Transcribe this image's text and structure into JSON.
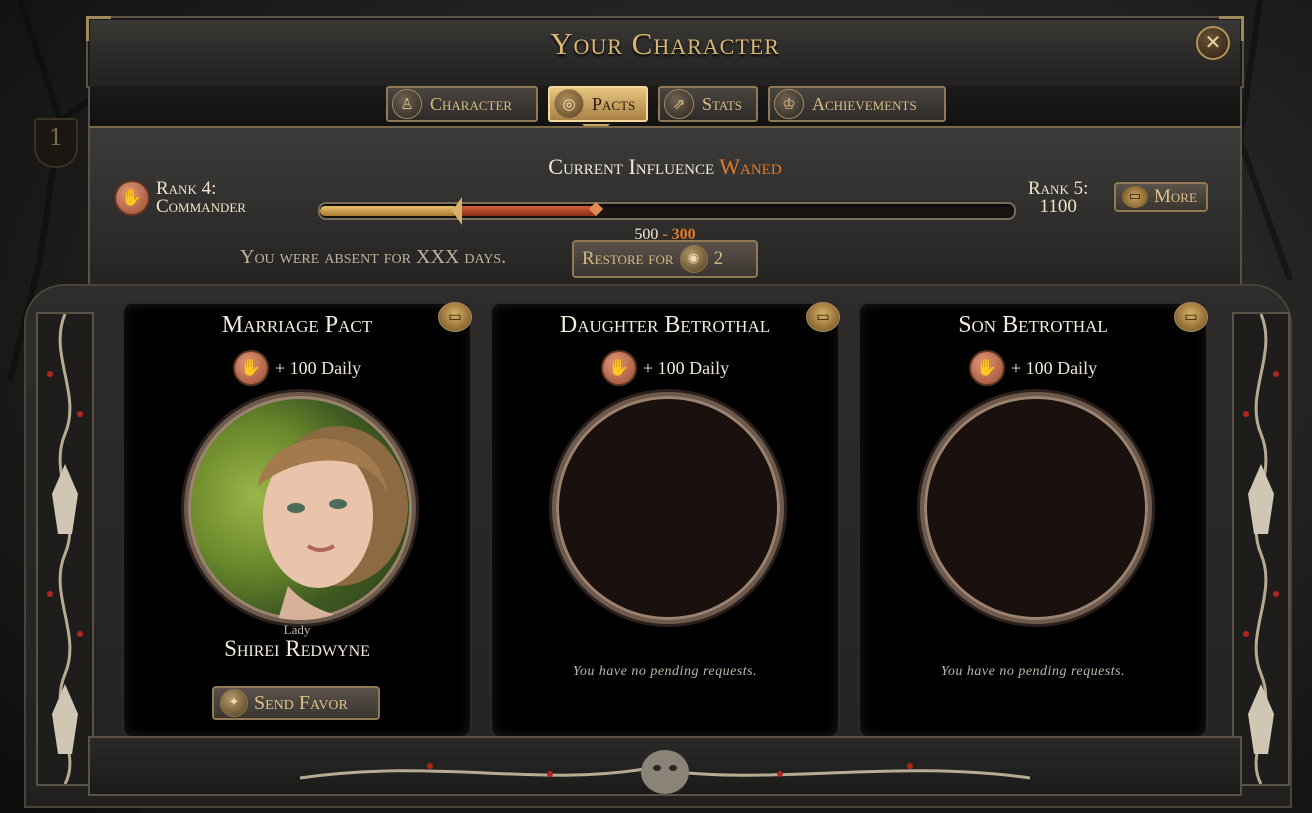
{
  "window": {
    "title": "Your Character",
    "close_icon": "close-icon"
  },
  "background": {
    "badge": "1"
  },
  "tabs": [
    {
      "label": "Character",
      "icon": "person-icon",
      "active": false
    },
    {
      "label": "Pacts",
      "icon": "rings-icon",
      "active": true
    },
    {
      "label": "Stats",
      "icon": "arrows-icon",
      "active": false
    },
    {
      "label": "Achievements",
      "icon": "trophy-icon",
      "active": false
    }
  ],
  "influence": {
    "title_prefix": "Current Influence",
    "state": "Waned",
    "rank_current_line1": "Rank 4:",
    "rank_current_line2": "Commander",
    "rank_next_line1": "Rank 5:",
    "rank_next_line2": "1100",
    "value": "500",
    "separator": "-",
    "loss": "300",
    "more_label": "More",
    "progress_fraction_gold": 0.2,
    "progress_fraction_red": 0.4
  },
  "absence": {
    "text": "You were absent for XXX days.",
    "restore_label": "Restore for",
    "restore_cost": "2"
  },
  "cards": [
    {
      "title": "Marriage Pact",
      "daily": "+ 100 Daily",
      "filled": true,
      "honorific": "Lady",
      "name": "Shirei Redwyne",
      "action_label": "Send Favor",
      "message": ""
    },
    {
      "title": "Daughter Betrothal",
      "daily": "+ 100 Daily",
      "filled": false,
      "message": "You have no pending requests."
    },
    {
      "title": "Son Betrothal",
      "daily": "+ 100 Daily",
      "filled": false,
      "message": "You have no pending requests."
    }
  ],
  "colors": {
    "gold": "#d9b673",
    "waned_orange": "#e07a26",
    "panel": "#2c2b29",
    "card_bg": "#000000"
  }
}
